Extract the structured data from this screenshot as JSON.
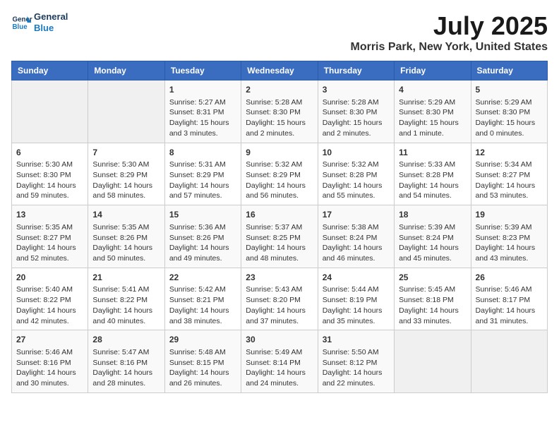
{
  "logo": {
    "line1": "General",
    "line2": "Blue"
  },
  "title": "July 2025",
  "subtitle": "Morris Park, New York, United States",
  "weekdays": [
    "Sunday",
    "Monday",
    "Tuesday",
    "Wednesday",
    "Thursday",
    "Friday",
    "Saturday"
  ],
  "weeks": [
    [
      {
        "day": "",
        "info": ""
      },
      {
        "day": "",
        "info": ""
      },
      {
        "day": "1",
        "info": "Sunrise: 5:27 AM\nSunset: 8:31 PM\nDaylight: 15 hours and 3 minutes."
      },
      {
        "day": "2",
        "info": "Sunrise: 5:28 AM\nSunset: 8:30 PM\nDaylight: 15 hours and 2 minutes."
      },
      {
        "day": "3",
        "info": "Sunrise: 5:28 AM\nSunset: 8:30 PM\nDaylight: 15 hours and 2 minutes."
      },
      {
        "day": "4",
        "info": "Sunrise: 5:29 AM\nSunset: 8:30 PM\nDaylight: 15 hours and 1 minute."
      },
      {
        "day": "5",
        "info": "Sunrise: 5:29 AM\nSunset: 8:30 PM\nDaylight: 15 hours and 0 minutes."
      }
    ],
    [
      {
        "day": "6",
        "info": "Sunrise: 5:30 AM\nSunset: 8:30 PM\nDaylight: 14 hours and 59 minutes."
      },
      {
        "day": "7",
        "info": "Sunrise: 5:30 AM\nSunset: 8:29 PM\nDaylight: 14 hours and 58 minutes."
      },
      {
        "day": "8",
        "info": "Sunrise: 5:31 AM\nSunset: 8:29 PM\nDaylight: 14 hours and 57 minutes."
      },
      {
        "day": "9",
        "info": "Sunrise: 5:32 AM\nSunset: 8:29 PM\nDaylight: 14 hours and 56 minutes."
      },
      {
        "day": "10",
        "info": "Sunrise: 5:32 AM\nSunset: 8:28 PM\nDaylight: 14 hours and 55 minutes."
      },
      {
        "day": "11",
        "info": "Sunrise: 5:33 AM\nSunset: 8:28 PM\nDaylight: 14 hours and 54 minutes."
      },
      {
        "day": "12",
        "info": "Sunrise: 5:34 AM\nSunset: 8:27 PM\nDaylight: 14 hours and 53 minutes."
      }
    ],
    [
      {
        "day": "13",
        "info": "Sunrise: 5:35 AM\nSunset: 8:27 PM\nDaylight: 14 hours and 52 minutes."
      },
      {
        "day": "14",
        "info": "Sunrise: 5:35 AM\nSunset: 8:26 PM\nDaylight: 14 hours and 50 minutes."
      },
      {
        "day": "15",
        "info": "Sunrise: 5:36 AM\nSunset: 8:26 PM\nDaylight: 14 hours and 49 minutes."
      },
      {
        "day": "16",
        "info": "Sunrise: 5:37 AM\nSunset: 8:25 PM\nDaylight: 14 hours and 48 minutes."
      },
      {
        "day": "17",
        "info": "Sunrise: 5:38 AM\nSunset: 8:24 PM\nDaylight: 14 hours and 46 minutes."
      },
      {
        "day": "18",
        "info": "Sunrise: 5:39 AM\nSunset: 8:24 PM\nDaylight: 14 hours and 45 minutes."
      },
      {
        "day": "19",
        "info": "Sunrise: 5:39 AM\nSunset: 8:23 PM\nDaylight: 14 hours and 43 minutes."
      }
    ],
    [
      {
        "day": "20",
        "info": "Sunrise: 5:40 AM\nSunset: 8:22 PM\nDaylight: 14 hours and 42 minutes."
      },
      {
        "day": "21",
        "info": "Sunrise: 5:41 AM\nSunset: 8:22 PM\nDaylight: 14 hours and 40 minutes."
      },
      {
        "day": "22",
        "info": "Sunrise: 5:42 AM\nSunset: 8:21 PM\nDaylight: 14 hours and 38 minutes."
      },
      {
        "day": "23",
        "info": "Sunrise: 5:43 AM\nSunset: 8:20 PM\nDaylight: 14 hours and 37 minutes."
      },
      {
        "day": "24",
        "info": "Sunrise: 5:44 AM\nSunset: 8:19 PM\nDaylight: 14 hours and 35 minutes."
      },
      {
        "day": "25",
        "info": "Sunrise: 5:45 AM\nSunset: 8:18 PM\nDaylight: 14 hours and 33 minutes."
      },
      {
        "day": "26",
        "info": "Sunrise: 5:46 AM\nSunset: 8:17 PM\nDaylight: 14 hours and 31 minutes."
      }
    ],
    [
      {
        "day": "27",
        "info": "Sunrise: 5:46 AM\nSunset: 8:16 PM\nDaylight: 14 hours and 30 minutes."
      },
      {
        "day": "28",
        "info": "Sunrise: 5:47 AM\nSunset: 8:16 PM\nDaylight: 14 hours and 28 minutes."
      },
      {
        "day": "29",
        "info": "Sunrise: 5:48 AM\nSunset: 8:15 PM\nDaylight: 14 hours and 26 minutes."
      },
      {
        "day": "30",
        "info": "Sunrise: 5:49 AM\nSunset: 8:14 PM\nDaylight: 14 hours and 24 minutes."
      },
      {
        "day": "31",
        "info": "Sunrise: 5:50 AM\nSunset: 8:12 PM\nDaylight: 14 hours and 22 minutes."
      },
      {
        "day": "",
        "info": ""
      },
      {
        "day": "",
        "info": ""
      }
    ]
  ]
}
